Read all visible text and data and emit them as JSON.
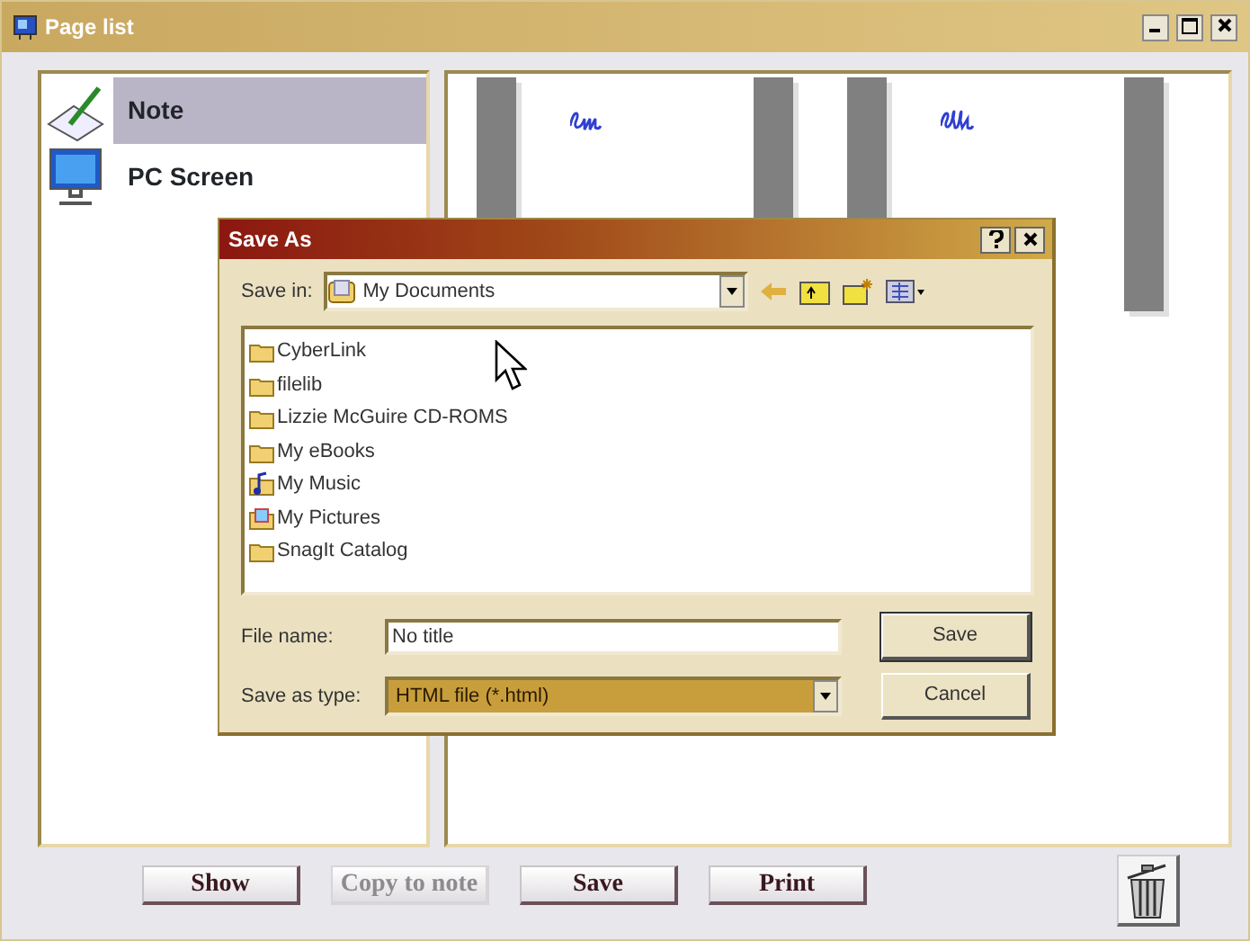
{
  "window": {
    "title": "Page list"
  },
  "sources": [
    {
      "label": "Note",
      "kind": "note",
      "selected": true
    },
    {
      "label": "PC Screen",
      "kind": "screen",
      "selected": false
    }
  ],
  "buttons": [
    {
      "label": "Show",
      "disabled": false
    },
    {
      "label": "Copy to note",
      "disabled": true
    },
    {
      "label": "Save",
      "disabled": false
    },
    {
      "label": "Print",
      "disabled": false
    }
  ],
  "dialog": {
    "title": "Save As",
    "save_in_label": "Save in:",
    "save_in": "My Documents",
    "files": [
      {
        "name": "CyberLink",
        "kind": "folder"
      },
      {
        "name": "filelib",
        "kind": "folder"
      },
      {
        "name": "Lizzie McGuire CD-ROMS",
        "kind": "folder"
      },
      {
        "name": "My eBooks",
        "kind": "folder"
      },
      {
        "name": "My Music",
        "kind": "music"
      },
      {
        "name": "My Pictures",
        "kind": "pictures"
      },
      {
        "name": "SnagIt Catalog",
        "kind": "folder"
      }
    ],
    "file_name_label": "File name:",
    "file_name": "No title",
    "type_label": "Save as type:",
    "type": "HTML file (*.html)",
    "buttons": [
      "Save",
      "Cancel"
    ]
  }
}
